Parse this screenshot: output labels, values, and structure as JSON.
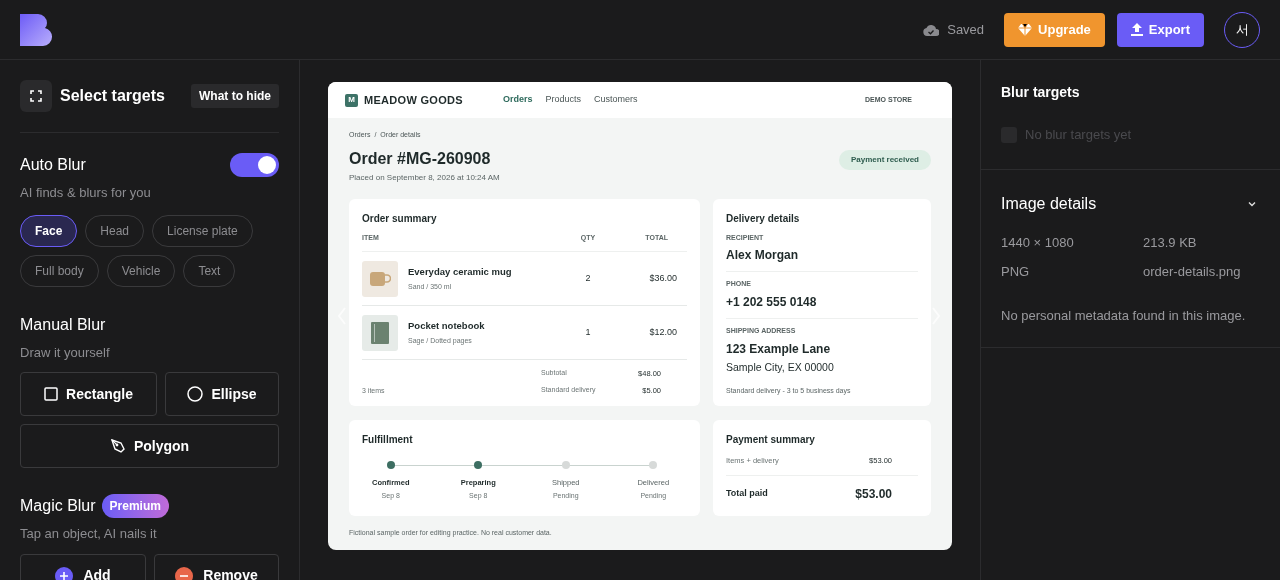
{
  "topbar": {
    "save_status": "Saved",
    "upgrade_button": "Upgrade",
    "export_button": "Export",
    "avatar": "서"
  },
  "left_panel": {
    "title": "Select targets",
    "hint_button": "What to hide",
    "auto_blur": {
      "title": "Auto Blur",
      "on": true,
      "subtitle": "AI finds & blurs for you",
      "chips": [
        {
          "label": "Face",
          "selected": true
        },
        {
          "label": "Head",
          "selected": false
        },
        {
          "label": "License plate",
          "selected": false
        },
        {
          "label": "Full body",
          "selected": false
        },
        {
          "label": "Vehicle",
          "selected": false
        },
        {
          "label": "Text",
          "selected": false
        }
      ]
    },
    "manual_blur": {
      "title": "Manual Blur",
      "subtitle": "Draw it yourself",
      "tools": [
        {
          "kind": "rectangle",
          "label": "Rectangle"
        },
        {
          "kind": "ellipse",
          "label": "Ellipse"
        },
        {
          "kind": "polygon",
          "label": "Polygon"
        }
      ]
    },
    "magic_blur": {
      "title": "Magic Blur",
      "badge": "Premium",
      "subtitle": "Tap an object, AI nails it",
      "actions": [
        {
          "kind": "add",
          "label": "Add"
        },
        {
          "kind": "remove",
          "label": "Remove"
        }
      ]
    }
  },
  "preview": {
    "brand_mark": "M",
    "brand": "MEADOW GOODS",
    "nav": [
      {
        "label": "Orders",
        "selected": true
      },
      {
        "label": "Products",
        "selected": false
      },
      {
        "label": "Customers",
        "selected": false
      }
    ],
    "store_label": "DEMO STORE",
    "breadcrumb": [
      "Orders",
      "Order details"
    ],
    "breadcrumb_separator": "/",
    "order_title": "Order #MG-260908",
    "placed": "Placed on September 8, 2026 at 10:24 AM",
    "status_badge": "Payment received",
    "order_summary": {
      "title": "Order summary",
      "columns": [
        "ITEM",
        "QTY",
        "TOTAL"
      ],
      "items": [
        {
          "kind": "mug",
          "name": "Everyday ceramic mug",
          "variant": "Sand / 350 ml",
          "qty": "2",
          "total": "$36.00"
        },
        {
          "kind": "notebook",
          "name": "Pocket notebook",
          "variant": "Sage / Dotted pages",
          "qty": "1",
          "total": "$12.00"
        }
      ],
      "count": "3 items",
      "lines": [
        {
          "label": "Subtotal",
          "value": "$48.00"
        },
        {
          "label": "Standard delivery",
          "value": "$5.00"
        }
      ]
    },
    "delivery": {
      "title": "Delivery details",
      "recipient_label": "RECIPIENT",
      "recipient": "Alex Morgan",
      "phone_label": "PHONE",
      "phone": "+1 202 555 0148",
      "address_label": "SHIPPING ADDRESS",
      "address_line1": "123 Example Lane",
      "address_line2": "Sample City, EX 00000",
      "note": "Standard delivery - 3 to 5 business days"
    },
    "fulfillment": {
      "title": "Fulfillment",
      "steps": [
        {
          "label": "Confirmed",
          "date": "Sep 8",
          "done": true
        },
        {
          "label": "Preparing",
          "date": "Sep 8",
          "done": true
        },
        {
          "label": "Shipped",
          "date": "Pending",
          "done": false
        },
        {
          "label": "Delivered",
          "date": "Pending",
          "done": false
        }
      ]
    },
    "payment": {
      "title": "Payment summary",
      "line_label": "Items + delivery",
      "line_value": "$53.00",
      "total_label": "Total paid",
      "total_value": "$53.00"
    },
    "footnote": "Fictional sample order for editing practice. No real customer data."
  },
  "right_panel": {
    "blur_targets": {
      "title": "Blur targets",
      "empty": "No blur targets yet",
      "checked": false
    },
    "image_details": {
      "title": "Image details",
      "expanded": true,
      "dimensions": "1440 × 1080",
      "size": "213.9 KB",
      "format": "PNG",
      "filename": "order-details.png",
      "note": "No personal metadata found in this image."
    }
  }
}
